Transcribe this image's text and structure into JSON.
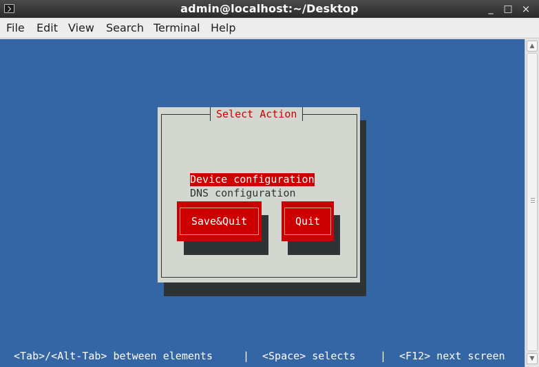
{
  "window": {
    "title": "admin@localhost:~/Desktop",
    "min_glyph": "_",
    "max_glyph": "□",
    "close_glyph": "×"
  },
  "menu": {
    "items": [
      "File",
      "Edit",
      "View",
      "Search",
      "Terminal",
      "Help"
    ]
  },
  "dialog": {
    "title": "Select Action",
    "options": [
      {
        "label": "Device configuration",
        "selected": true
      },
      {
        "label": "DNS configuration",
        "selected": false
      }
    ],
    "buttons": {
      "save_quit": "Save&Quit",
      "quit": "Quit"
    }
  },
  "help": {
    "tab": "<Tab>/<Alt-Tab> between elements",
    "sep1": "|",
    "space": "<Space> selects",
    "sep2": "|",
    "f12": "<F12> next screen"
  },
  "colors": {
    "terminal_bg": "#3465a4",
    "dialog_bg": "#d3d7cf",
    "accent_red": "#cc0000",
    "shadow": "#2e3436"
  },
  "icons": {
    "app": "terminal-icon",
    "scroll_up": "chevron-up-icon",
    "scroll_down": "chevron-down-icon"
  }
}
